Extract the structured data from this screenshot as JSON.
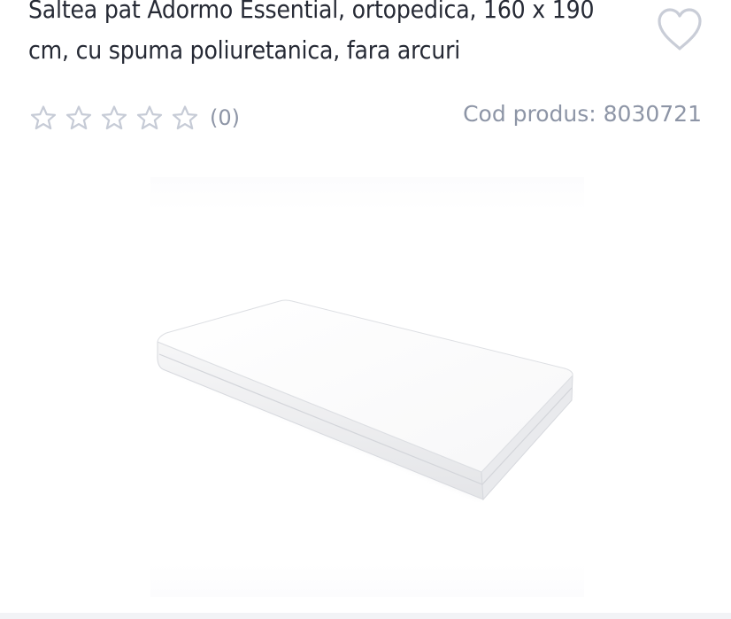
{
  "product": {
    "title": "Saltea pat Adormo Essential, ortopedica, 160 x 190 cm, cu spuma poliuretanica, fara arcuri",
    "rating_count": "(0)",
    "product_code": "Cod produs: 8030721"
  },
  "rating": {
    "stars_filled": 0,
    "stars_total": 5
  },
  "icons": {
    "favorite": "heart-outline-icon",
    "star": "star-outline-icon"
  },
  "colors": {
    "text": "#262a35",
    "muted": "#8d95a6",
    "icon": "#c6cbd6"
  }
}
